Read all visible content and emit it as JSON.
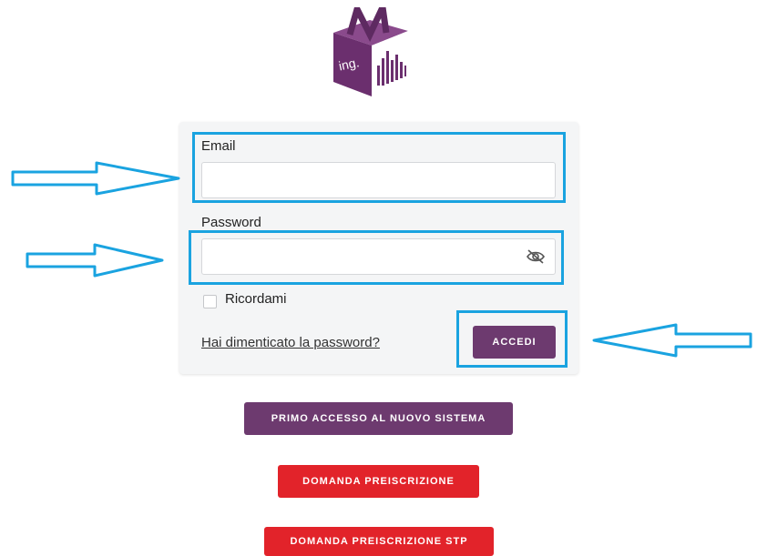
{
  "logo": {
    "text": "ing.",
    "icon": "cube-m-logo"
  },
  "login": {
    "email_label": "Email",
    "email_value": "",
    "password_label": "Password",
    "password_value": "",
    "toggle_icon": "eye-off-icon",
    "remember_label": "Ricordami",
    "forgot_link": "Hai dimenticato la password?",
    "submit_label": "ACCEDI"
  },
  "actions": {
    "first_access": "PRIMO ACCESSO AL NUOVO SISTEMA",
    "preregistration": "DOMANDA PREISCRIZIONE",
    "preregistration_stp": "DOMANDA PREISCRIZIONE STP"
  },
  "annotations": {
    "arrow_icon": "arrow-right-outline-icon",
    "highlight_color": "#1aa3e0"
  },
  "colors": {
    "brand_purple": "#6d3a6f",
    "action_red": "#e2232a",
    "card_background": "#f4f5f6"
  }
}
